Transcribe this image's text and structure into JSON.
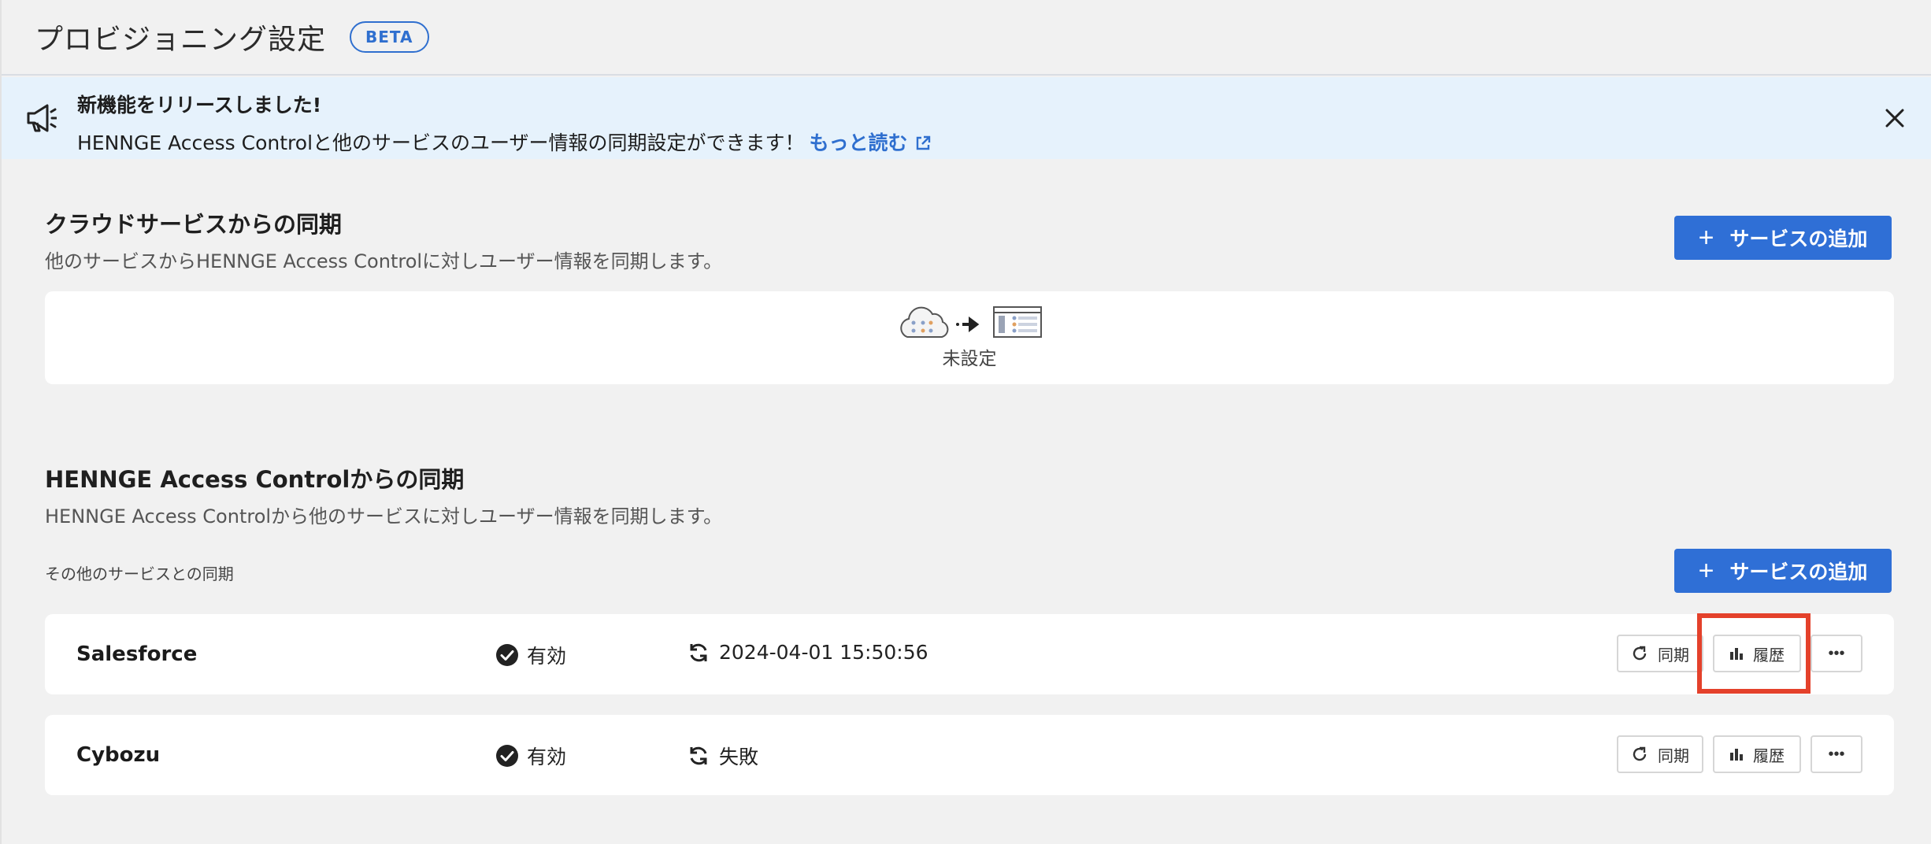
{
  "header": {
    "title": "プロビジョニング設定",
    "badge": "BETA"
  },
  "banner": {
    "icon": "megaphone-icon",
    "title": "新機能をリリースしました!",
    "body": "HENNGE Access Controlと他のサービスのユーザー情報の同期設定ができます！",
    "link_label": "もっと読む",
    "link_icon": "external-link-icon",
    "close_icon": "close-icon"
  },
  "cloud_section": {
    "title": "クラウドサービスからの同期",
    "description": "他のサービスからHENNGE Access Controlに対しユーザー情報を同期します。",
    "add_button_label": "サービスの追加",
    "empty_label": "未設定"
  },
  "hac_section": {
    "title": "HENNGE Access Controlからの同期",
    "description": "HENNGE Access Controlから他のサービスに対しユーザー情報を同期します。",
    "sub_label": "その他のサービスとの同期",
    "add_button_label": "サービスの追加",
    "rows": [
      {
        "name": "Salesforce",
        "status": "有効",
        "sync_result": "2024-04-01 15:50:56",
        "sync_label": "同期",
        "history_label": "履歴",
        "more_label": "•••"
      },
      {
        "name": "Cybozu",
        "status": "有効",
        "sync_result": "失敗",
        "sync_label": "同期",
        "history_label": "履歴",
        "more_label": "•••"
      }
    ]
  },
  "colors": {
    "accent": "#2f6fd6",
    "banner_bg": "#e6f2fc",
    "highlight": "#e4412b"
  }
}
